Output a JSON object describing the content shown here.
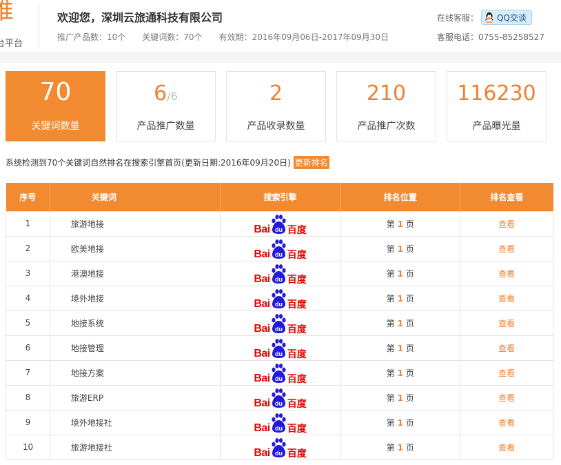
{
  "header": {
    "logo_char": "推",
    "logo_sub": "台平台",
    "welcome": "欢迎您，深圳云旅通科技有限公司",
    "promo_products": "推广产品数：10个",
    "keywords_count": "关键词数：70个",
    "validity": "有效期：2016年09月06日-2017年09月30日",
    "online_service_label": "在线客服：",
    "qq_button": "QQ交谈",
    "phone": "客服电话：0755-85258527"
  },
  "stats": [
    {
      "num": "70",
      "sub": "",
      "label": "关键词数量"
    },
    {
      "num": "6",
      "sub": "/6",
      "label": "产品推广数量"
    },
    {
      "num": "2",
      "sub": "",
      "label": "产品收录数量"
    },
    {
      "num": "210",
      "sub": "",
      "label": "产品推广次数"
    },
    {
      "num": "116230",
      "sub": "",
      "label": "产品曝光量"
    }
  ],
  "notice": {
    "text": "系统检测到70个关键词自然排名在搜索引擎首页(更新日期:2016年09月20日)",
    "refresh_label": "更新排名"
  },
  "table": {
    "headers": [
      "序号",
      "关键词",
      "搜索引擎",
      "排名位置",
      "排名查看"
    ],
    "engine": {
      "bai": "Bai",
      "du": "du",
      "cn": "百度"
    },
    "rank_prefix": "第",
    "rank_suffix": "页",
    "view_label": "查看",
    "rows": [
      {
        "idx": "1",
        "keyword": "旅游地接",
        "rank": "1"
      },
      {
        "idx": "2",
        "keyword": "欧美地接",
        "rank": "1"
      },
      {
        "idx": "3",
        "keyword": "港澳地接",
        "rank": "1"
      },
      {
        "idx": "4",
        "keyword": "境外地接",
        "rank": "1"
      },
      {
        "idx": "5",
        "keyword": "地接系统",
        "rank": "1"
      },
      {
        "idx": "6",
        "keyword": "地接管理",
        "rank": "1"
      },
      {
        "idx": "7",
        "keyword": "地接方案",
        "rank": "1"
      },
      {
        "idx": "8",
        "keyword": "旅游ERP",
        "rank": "1"
      },
      {
        "idx": "9",
        "keyword": "境外地接社",
        "rank": "1"
      },
      {
        "idx": "10",
        "keyword": "旅游地接社",
        "rank": "1"
      }
    ]
  },
  "colors": {
    "accent": "#f18a30",
    "baidu_red": "#e10602",
    "baidu_blue": "#2319dc"
  }
}
